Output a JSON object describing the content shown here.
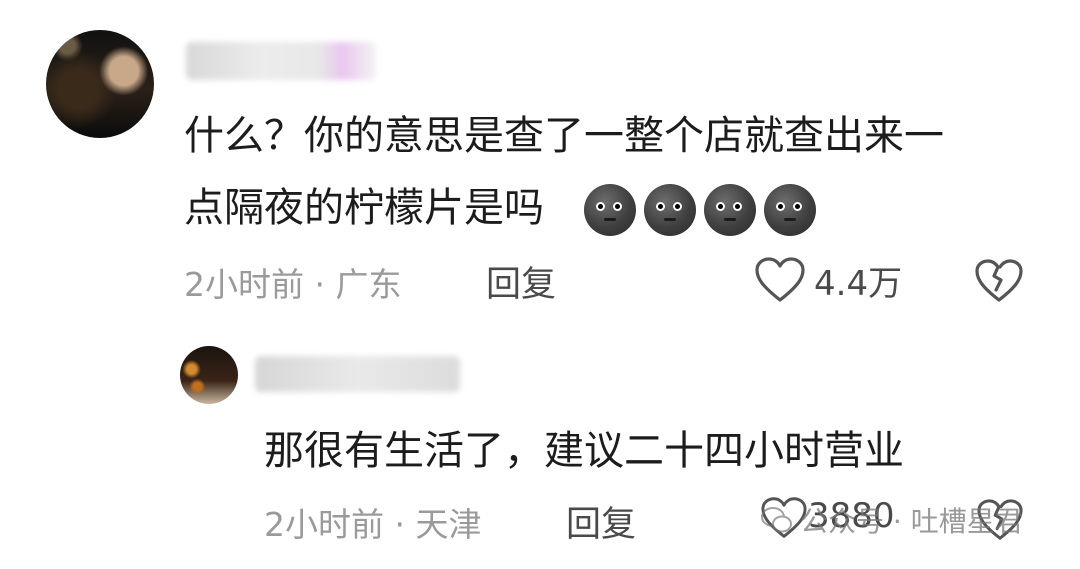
{
  "comments": [
    {
      "text_line1": "什么？你的意思是查了一整个店就查出来一",
      "text_line2": "点隔夜的柠檬片是吗",
      "emoji_count": 4,
      "emoji": "new-moon-face-icon",
      "time": "2小时前",
      "location": "广东",
      "meta": "2小时前 · 广东",
      "reply_label": "回复",
      "likes": "4.4万"
    },
    {
      "text": "那很有生活了，建议二十四小时营业",
      "time": "2小时前",
      "location": "天津",
      "meta": "2小时前 · 天津",
      "reply_label": "回复",
      "likes": "3880"
    }
  ],
  "watermark": "公众号 · 吐槽星君",
  "colors": {
    "text": "#1c1c1c",
    "meta": "#9a9a9a",
    "action": "#4a4a4a"
  }
}
